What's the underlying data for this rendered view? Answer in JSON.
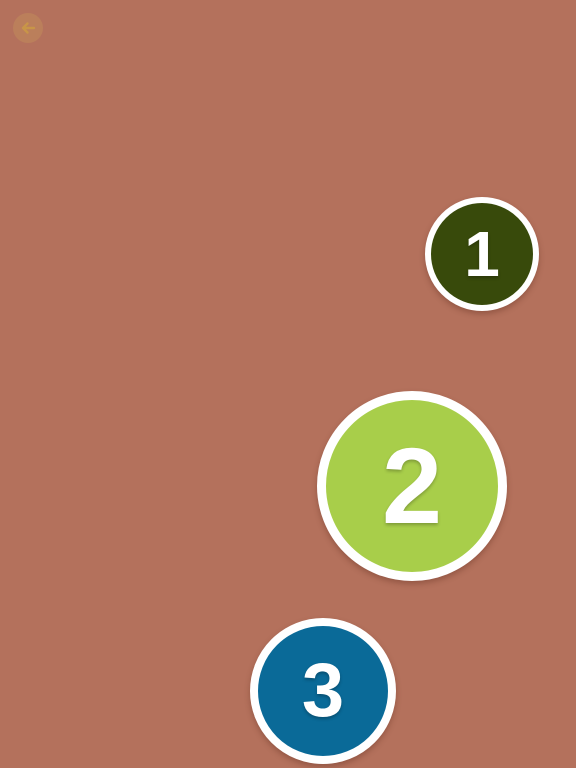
{
  "background_color": "#b4715c",
  "back_button": {
    "icon": "arrow-left-icon",
    "color": "#bb7f5b",
    "arrow_color": "#c89548"
  },
  "bubbles": [
    {
      "label": "1",
      "color": "#384a0b"
    },
    {
      "label": "2",
      "color": "#a8ce4a"
    },
    {
      "label": "3",
      "color": "#0a6a98"
    }
  ]
}
